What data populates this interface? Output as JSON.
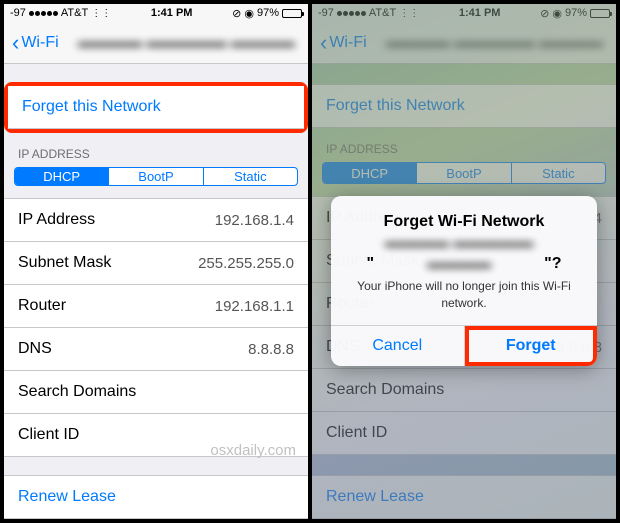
{
  "status": {
    "signal": "-97",
    "carrier": "AT&T",
    "time": "1:41 PM",
    "alarm_icon": "⏰",
    "lock_icon": "⊘",
    "battery_pct": "97%"
  },
  "header": {
    "back_label": "Wi-Fi",
    "title": "▬▬▬▬ ▬▬▬▬▬ ▬▬▬▬"
  },
  "forget_label": "Forget this Network",
  "section_ip": "IP ADDRESS",
  "segmented": {
    "dhcp": "DHCP",
    "bootp": "BootP",
    "static": "Static"
  },
  "rows": {
    "ip_label": "IP Address",
    "ip_val": "192.168.1.4",
    "subnet_label": "Subnet Mask",
    "subnet_val": "255.255.255.0",
    "router_label": "Router",
    "router_val": "192.168.1.1",
    "dns_label": "DNS",
    "dns_val": "8.8.8.8",
    "search_label": "Search Domains",
    "search_val": "",
    "client_label": "Client ID",
    "client_val": ""
  },
  "renew_label": "Renew Lease",
  "watermark": "osxdaily.com",
  "alert": {
    "title_prefix": "Forget Wi-Fi Network",
    "title_name": "▬▬▬▬ ▬▬▬▬▬ ▬▬▬▬",
    "title_suffix": "?",
    "message": "Your iPhone will no longer join this Wi-Fi network.",
    "cancel": "Cancel",
    "forget": "Forget"
  },
  "right_ip_val": "4"
}
